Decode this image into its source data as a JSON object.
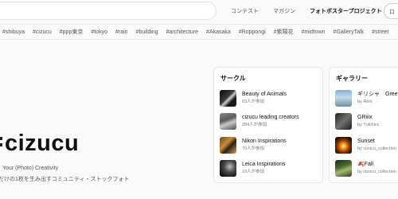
{
  "header": {
    "nav": [
      "コンテスト",
      "マガジン",
      "フォトポスタープロジェクト"
    ],
    "nav_button": "ロ"
  },
  "tags": [
    "#shibuya",
    "#cizucu",
    "#ppp東京",
    "#tokyo",
    "#rain",
    "#building",
    "#architecture",
    "#Akasaka",
    "#Roppongi",
    "#紫陽花",
    "#midtown",
    "#GalleryTalk",
    "#street"
  ],
  "hero": {
    "logo": "cizucu",
    "tagline": "Your (Photo) Creativity",
    "subline": "だけの1枚を生み出すコミュニティ・ストックフォト"
  },
  "circles": {
    "title": "サークル",
    "items": [
      {
        "name": "Beauty of Animals",
        "meta": "63人が参加"
      },
      {
        "name": "cizucu leading creators",
        "meta": "284人が参加"
      },
      {
        "name": "Nikon Inspirations",
        "meta": "70人が参加"
      },
      {
        "name": "Leica Inspirations",
        "meta": "19人が参加"
      }
    ]
  },
  "gallery": {
    "title": "ギャラリー",
    "items": [
      {
        "name": "ギリシャ　Greece",
        "meta": "by Reiri"
      },
      {
        "name": "GRiiix",
        "meta": "by Yukihiro"
      },
      {
        "name": "Sunset",
        "meta": "by cizucu_collection"
      },
      {
        "name": "🍂Fall",
        "meta": "by cizucu_collection"
      }
    ]
  }
}
